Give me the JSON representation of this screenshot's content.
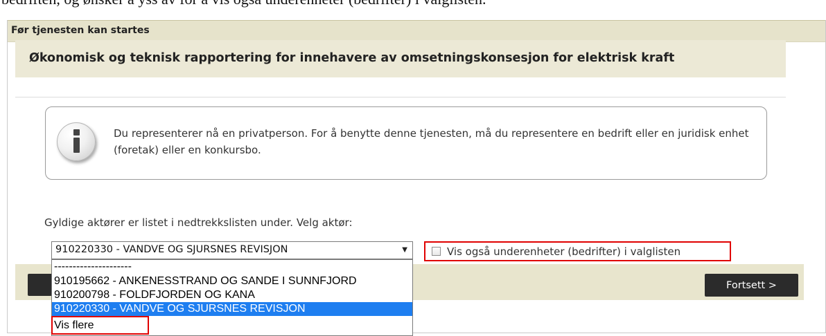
{
  "top_cut_text": "bedriften, og ønsker å yss av for å vis også underenheter (bedrifter) i valglisten.",
  "panel": {
    "header": "Før tjenesten kan startes",
    "service_title": "Økonomisk og teknisk rapportering for innehavere av omsetningskonsesjon for elektrisk kraft"
  },
  "info": {
    "icon": "info-icon",
    "message": "Du representerer nå en privatperson. For å benytte denne tjenesten, må du representere en bedrift eller en juridisk enhet (foretak) eller en konkursbo."
  },
  "actor_select": {
    "prompt": "Gyldige aktører er listet i nedtrekkslisten under. Velg aktør:",
    "selected_value": "910220330 - VANDVE OG SJURSNES REVISJON",
    "options": [
      "---------------------",
      "910195662 - ANKENESSTRAND OG SANDE I SUNNFJORD",
      "910200798 - FOLDFJORDEN OG KANA",
      "910220330 - VANDVE OG SJURSNES REVISJON",
      "Vis flere"
    ],
    "selected_index": 3
  },
  "checkbox": {
    "label": "Vis også underenheter (bedrifter) i valglisten",
    "checked": false
  },
  "buttons": {
    "back_label": "<",
    "next_label": "Fortsett >"
  },
  "colors": {
    "header_bg": "#e6e3cb",
    "button_bg": "#2b2b2b",
    "highlight": "#1e7ef0",
    "annotation_red": "#e00000"
  }
}
